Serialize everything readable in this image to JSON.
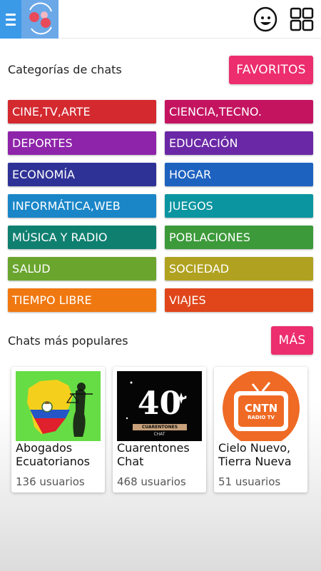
{
  "categories_label": "Categorías de chats",
  "favorites_label": "FAVORITOS",
  "categories": [
    {
      "label": "CINE,TV,ARTE",
      "color": "#d3292f"
    },
    {
      "label": "CIENCIA,TECNO.",
      "color": "#c41460"
    },
    {
      "label": "DEPORTES",
      "color": "#8e24aa"
    },
    {
      "label": "EDUCACIÓN",
      "color": "#6a28a6"
    },
    {
      "label": "ECONOMÍA",
      "color": "#2e3296"
    },
    {
      "label": "HOGAR",
      "color": "#1e62c0"
    },
    {
      "label": "INFORMÁTICA,WEB",
      "color": "#1a86c8"
    },
    {
      "label": "JUEGOS",
      "color": "#0a95a0"
    },
    {
      "label": "MÚSICA Y RADIO",
      "color": "#0f7f70"
    },
    {
      "label": "POBLACIONES",
      "color": "#3c9a3a"
    },
    {
      "label": "SALUD",
      "color": "#6aa52e"
    },
    {
      "label": "SOCIEDAD",
      "color": "#b0a220"
    },
    {
      "label": "TIEMPO LIBRE",
      "color": "#f07810"
    },
    {
      "label": "VIAJES",
      "color": "#e0461a"
    }
  ],
  "popular_label": "Chats más populares",
  "more_label": "MÁS",
  "popular_chats": [
    {
      "title": "Abogados Ecuatorianos",
      "users": "136 usuarios"
    },
    {
      "title": "Cuarentones Chat",
      "users": "468 usuarios",
      "thumb_number": "40",
      "thumb_caption": "CUARENTONES",
      "thumb_caption2": "CHAT"
    },
    {
      "title": "Cielo Nuevo, Tierra Nueva",
      "users": "51 usuarios",
      "thumb_line1": "CNTN",
      "thumb_line2": "RADIO TV"
    }
  ],
  "colors": {
    "accent": "#ec2d6e",
    "menu_blue": "#3b9ae8"
  }
}
